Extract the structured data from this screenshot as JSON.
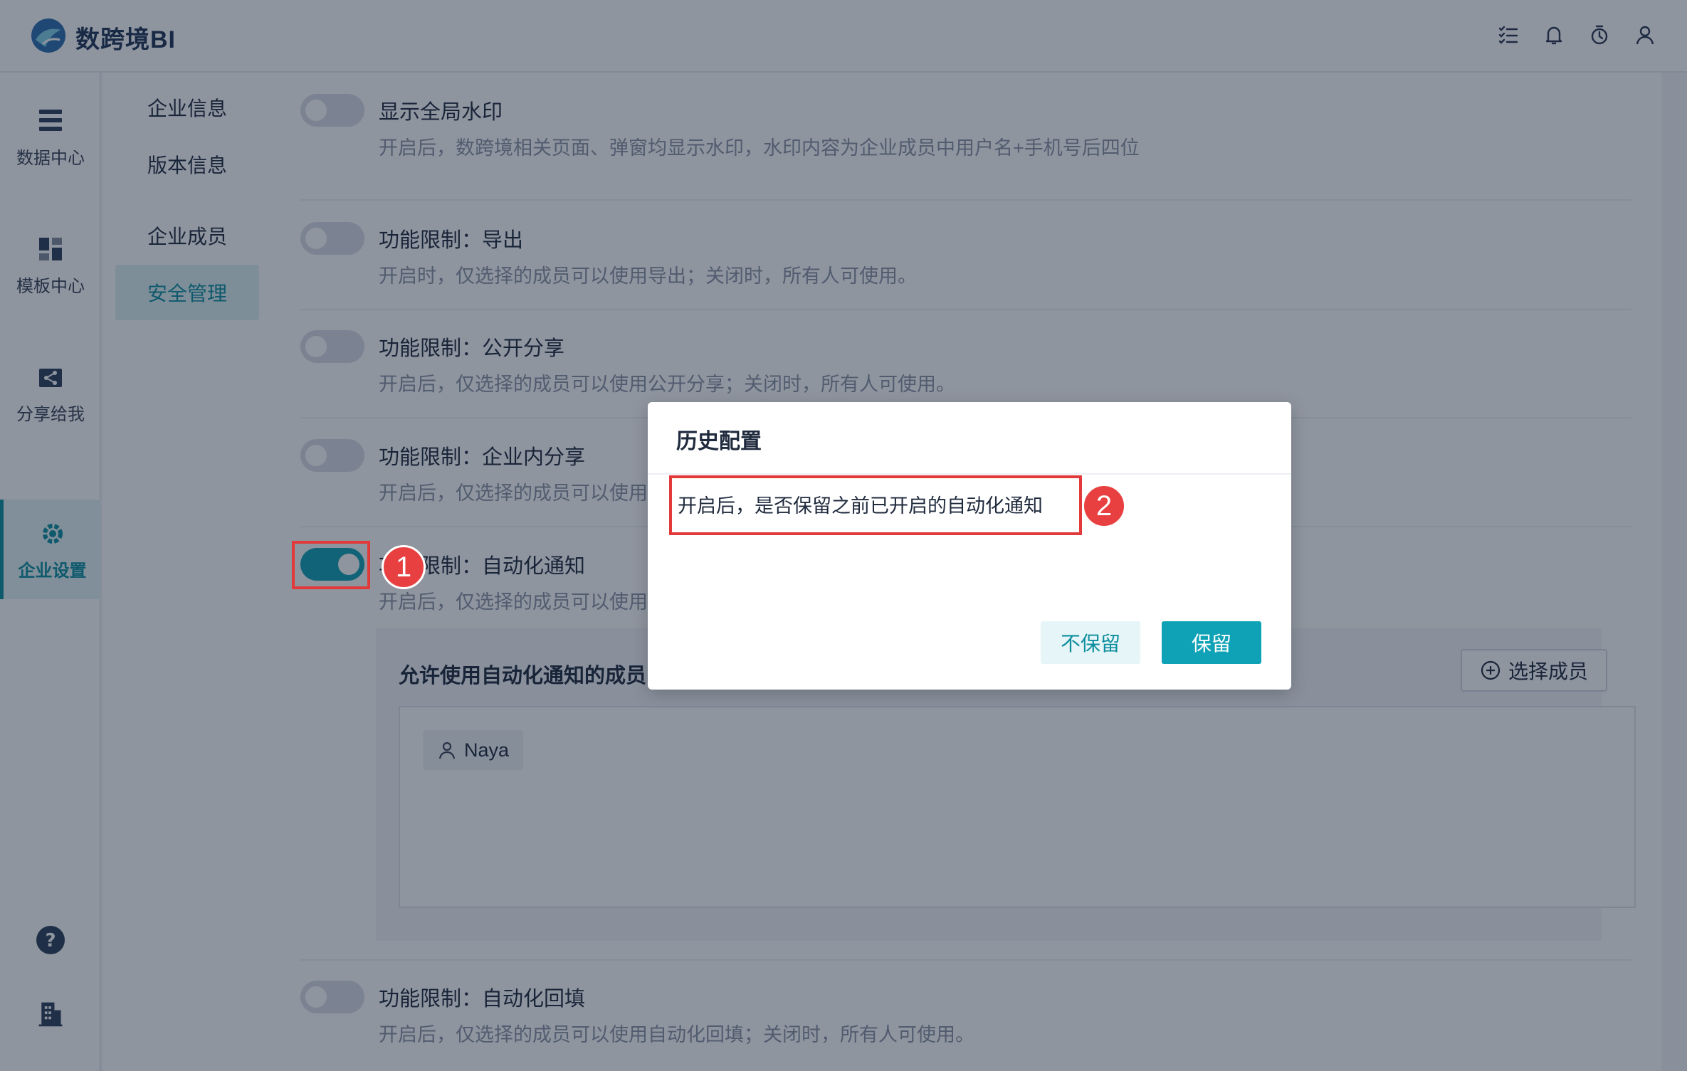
{
  "app": {
    "brand": "数跨境BI"
  },
  "colors": {
    "accent": "#0fa2b6",
    "annotation": "#e84040"
  },
  "top_icons": [
    "task-list-icon",
    "bell-icon",
    "timer-icon",
    "user-icon"
  ],
  "leftnav": {
    "items": [
      {
        "label": "数据中心",
        "icon": "data-center-icon"
      },
      {
        "label": "模板中心",
        "icon": "template-icon"
      },
      {
        "label": "分享给我",
        "icon": "share-icon"
      },
      {
        "label": "企业设置",
        "icon": "settings-gear-icon",
        "active": true
      }
    ],
    "bottom": [
      "help-icon",
      "building-icon"
    ]
  },
  "subnav": {
    "items": [
      {
        "label": "企业信息"
      },
      {
        "label": "版本信息"
      },
      {
        "label": "企业成员"
      },
      {
        "label": "安全管理",
        "active": true
      }
    ]
  },
  "settings": [
    {
      "title": "显示全局水印",
      "desc": "开启后，数跨境相关页面、弹窗均显示水印，水印内容为企业成员中用户名+手机号后四位",
      "on": false
    },
    {
      "title": "功能限制：导出",
      "desc": "开启时，仅选择的成员可以使用导出；关闭时，所有人可使用。",
      "on": false
    },
    {
      "title": "功能限制：公开分享",
      "desc": "开启后，仅选择的成员可以使用公开分享；关闭时，所有人可使用。",
      "on": false
    },
    {
      "title": "功能限制：企业内分享",
      "desc": "开启后，仅选择的成员可以使用",
      "on": false
    },
    {
      "title": "功能限制：自动化通知",
      "desc": "开启后，仅选择的成员可以使用",
      "on": true
    },
    {
      "title": "功能限制：自动化回填",
      "desc": "开启后，仅选择的成员可以使用自动化回填；关闭时，所有人可使用。",
      "on": false
    }
  ],
  "members_panel": {
    "title": "允许使用自动化通知的成员",
    "select_button": "选择成员",
    "members": [
      "Naya"
    ]
  },
  "modal": {
    "title": "历史配置",
    "body": "开启后，是否保留之前已开启的自动化通知",
    "cancel": "不保留",
    "confirm": "保留"
  },
  "annotations": [
    "1",
    "2"
  ]
}
